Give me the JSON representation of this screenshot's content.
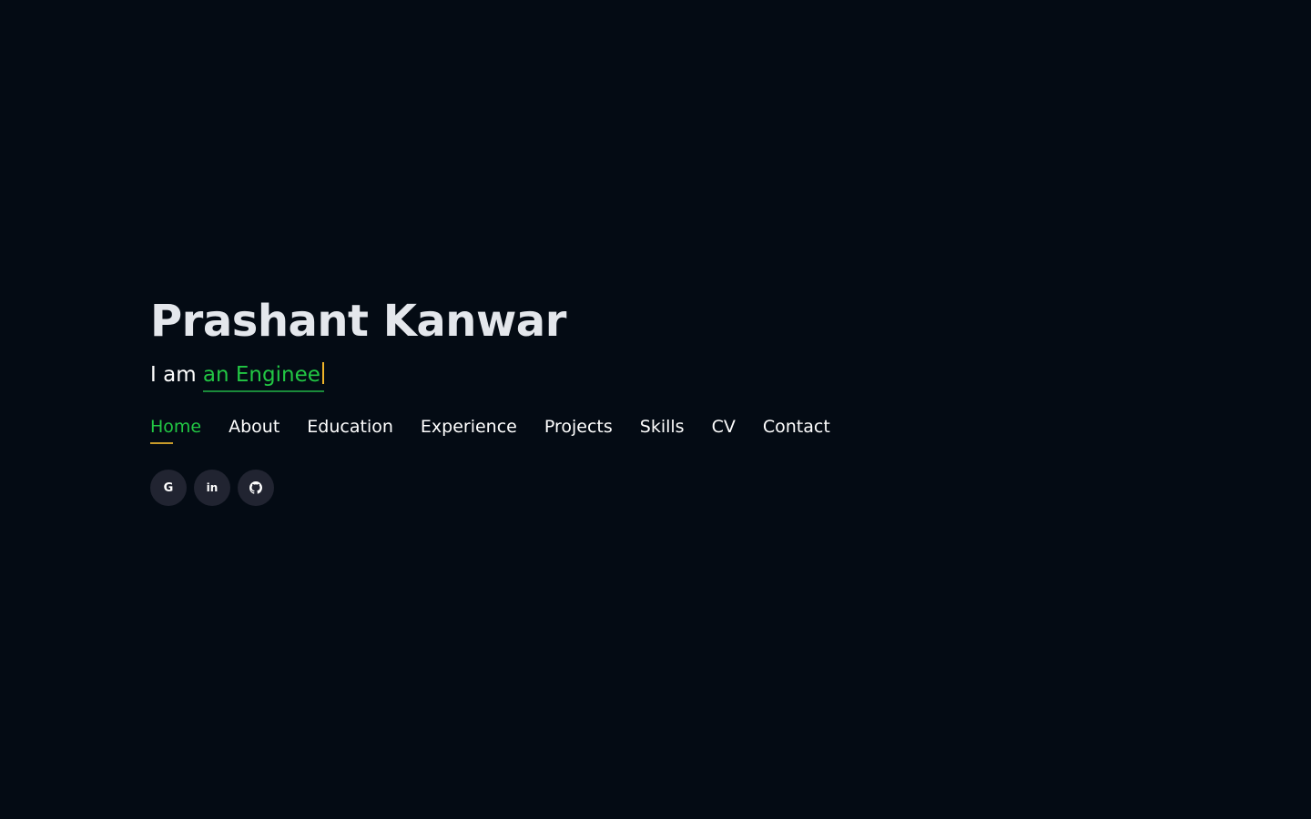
{
  "hero": {
    "name": "Prashant Kanwar",
    "tagline_prefix": "I am ",
    "tagline_typed": "an Enginee"
  },
  "nav": {
    "items": [
      {
        "label": "Home",
        "active": true
      },
      {
        "label": "About",
        "active": false
      },
      {
        "label": "Education",
        "active": false
      },
      {
        "label": "Experience",
        "active": false
      },
      {
        "label": "Projects",
        "active": false
      },
      {
        "label": "Skills",
        "active": false
      },
      {
        "label": "CV",
        "active": false
      },
      {
        "label": "Contact",
        "active": false
      }
    ]
  },
  "social": {
    "items": [
      {
        "icon": "google-icon",
        "glyph": "G"
      },
      {
        "icon": "linkedin-icon",
        "glyph": "in"
      },
      {
        "icon": "github-icon",
        "glyph": ""
      }
    ]
  },
  "colors": {
    "background": "#040b14",
    "accent_green": "#22c744",
    "cursor_gold": "#f0b429",
    "icon_bg": "#212431",
    "name_color": "#e4e7ec"
  }
}
